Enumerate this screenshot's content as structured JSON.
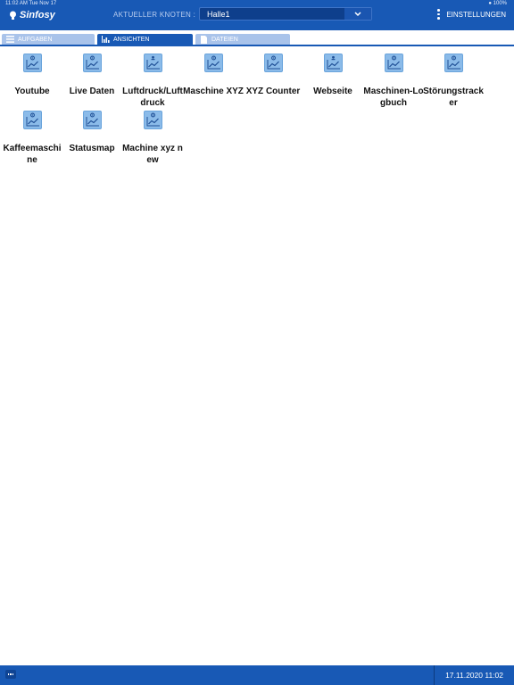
{
  "status_bar": {
    "time_date": "11:02 AM   Tue Nov 17",
    "battery": "100%"
  },
  "header": {
    "logo_text": "Sinfosy",
    "node_label": "AKTUELLER KNOTEN :",
    "node_value": "Halle1",
    "settings_label": "EINSTELLUNGEN"
  },
  "tabs": [
    {
      "label": "AUFGABEN",
      "icon": "list-icon",
      "active": false
    },
    {
      "label": "ANSICHTEN",
      "icon": "bar-chart-icon",
      "active": true
    },
    {
      "label": "DATEIEN",
      "icon": "file-icon",
      "active": false
    }
  ],
  "views": [
    {
      "label": "Youtube",
      "icon": "chart-gear-icon"
    },
    {
      "label": "Live Daten",
      "icon": "chart-gear-icon"
    },
    {
      "label": "Luftdruck/Luftdruck",
      "icon": "chart-person-icon"
    },
    {
      "label": "Maschine XYZ",
      "icon": "chart-gear-icon"
    },
    {
      "label": "XYZ Counter",
      "icon": "chart-gear-icon"
    },
    {
      "label": "Webseite",
      "icon": "chart-person-icon"
    },
    {
      "label": "Maschinen-Logbuch",
      "icon": "chart-gear-icon"
    },
    {
      "label": "Störungstracker",
      "icon": "chart-gear-icon"
    },
    {
      "label": "Kaffeemaschine",
      "icon": "chart-gear-icon"
    },
    {
      "label": "Statusmap",
      "icon": "chart-gear-icon"
    },
    {
      "label": "Machine xyz new",
      "icon": "chart-gear-icon"
    }
  ],
  "footer": {
    "datetime": "17.11.2020 11:02"
  },
  "colors": {
    "primary": "#1859b5",
    "tab_inactive": "#a9c3ea",
    "icon_tile": "#8bbbe9"
  }
}
